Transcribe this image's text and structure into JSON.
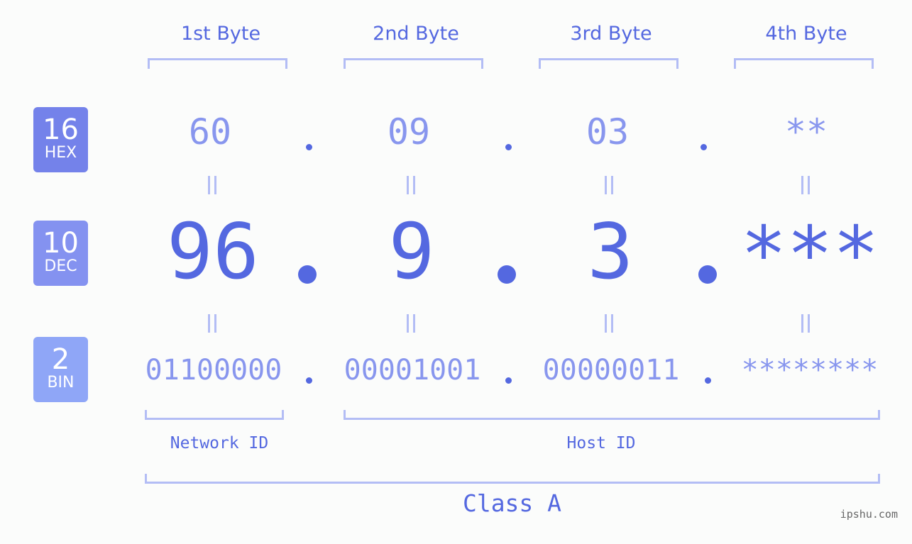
{
  "bytes": {
    "headers": [
      "1st Byte",
      "2nd Byte",
      "3rd Byte",
      "4th Byte"
    ]
  },
  "rows": {
    "hex": {
      "base": "16",
      "label": "HEX",
      "color": "#7482ea",
      "values": [
        "60",
        "09",
        "03",
        "**"
      ]
    },
    "dec": {
      "base": "10",
      "label": "DEC",
      "color": "#8492f0",
      "values": [
        "96",
        "9",
        "3",
        "***"
      ]
    },
    "bin": {
      "base": "2",
      "label": "BIN",
      "color": "#8fa6f7",
      "values": [
        "01100000",
        "00001001",
        "00000011",
        "********"
      ]
    }
  },
  "separator": ".",
  "segments": {
    "network_id": "Network ID",
    "host_id": "Host ID",
    "class": "Class A"
  },
  "colors": {
    "accent": "#5468e0",
    "light_value": "#8896ee",
    "bracket": "#b3bdf5",
    "background": "#fbfcfb"
  },
  "watermark": "ipshu.com"
}
